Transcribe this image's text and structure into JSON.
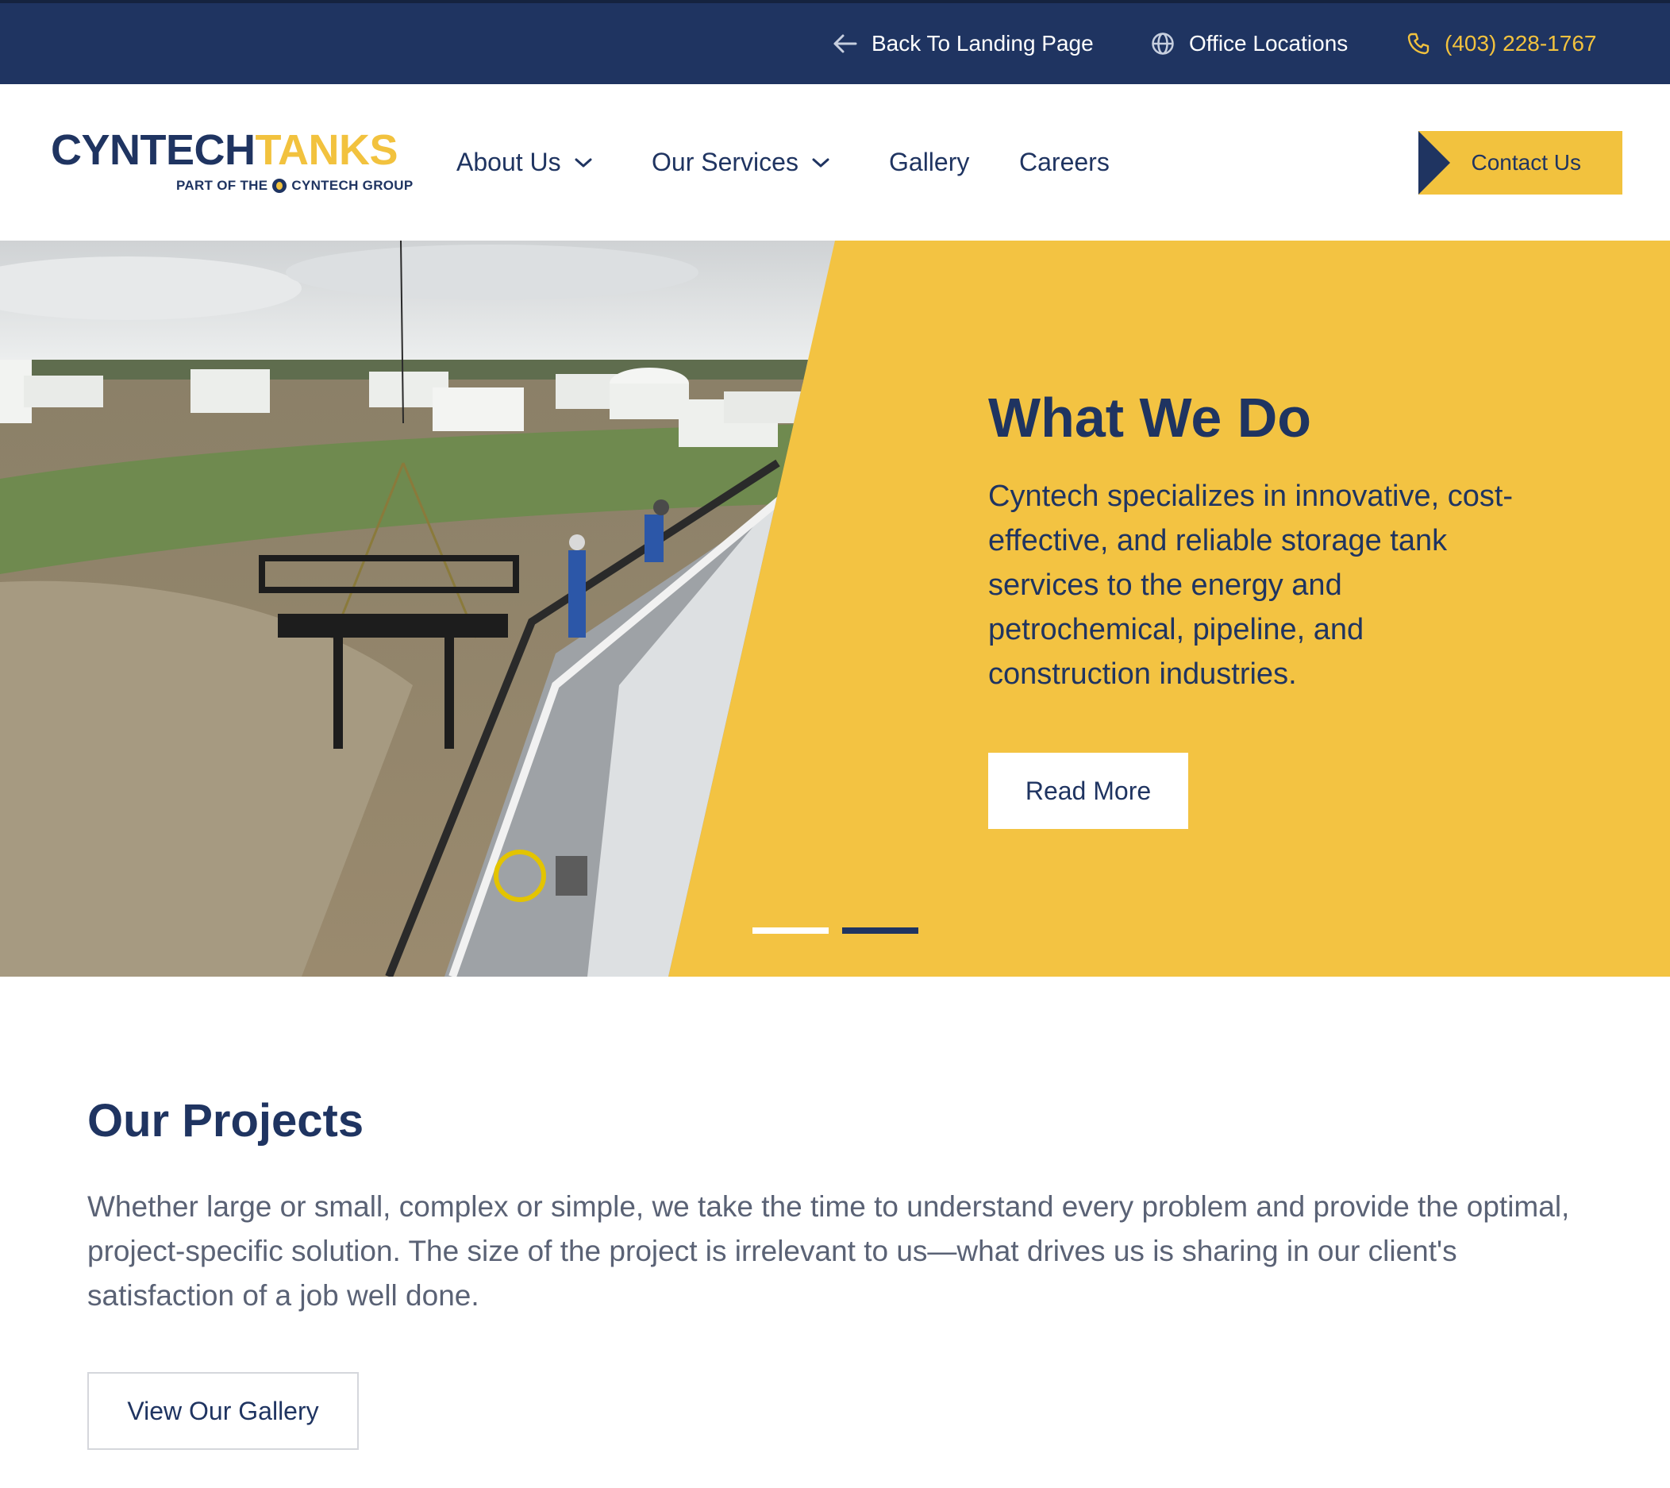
{
  "topbar": {
    "back_label": "Back To Landing Page",
    "locations_label": "Office Locations",
    "phone": "(403) 228-1767"
  },
  "logo": {
    "word1": "CYNTECH",
    "word2": "TANKS",
    "sub_pre": "PART OF THE",
    "sub_post": "CYNTECH GROUP"
  },
  "nav": {
    "about": "About Us",
    "services": "Our Services",
    "gallery": "Gallery",
    "careers": "Careers",
    "contact": "Contact Us"
  },
  "hero": {
    "title": "What We Do",
    "description": "Cyntech specializes in innovative, cost-effective, and reliable storage tank services to the energy and petrochemical, pipeline, and construction industries.",
    "button": "Read More",
    "active_slide": 1,
    "slide_count": 2
  },
  "projects": {
    "title": "Our Projects",
    "description": "Whether large or small, complex or simple, we take the time to understand every problem and provide the optimal, project-specific solution. The size of the project is irrelevant to us—what drives us is sharing in our client's satisfaction of a job well done.",
    "button": "View Our Gallery"
  },
  "colors": {
    "navy": "#1f3461",
    "yellow": "#f2c23e",
    "body_text": "#5a6275"
  },
  "icons": [
    "arrow-left-icon",
    "globe-icon",
    "phone-icon",
    "chevron-down-icon"
  ]
}
